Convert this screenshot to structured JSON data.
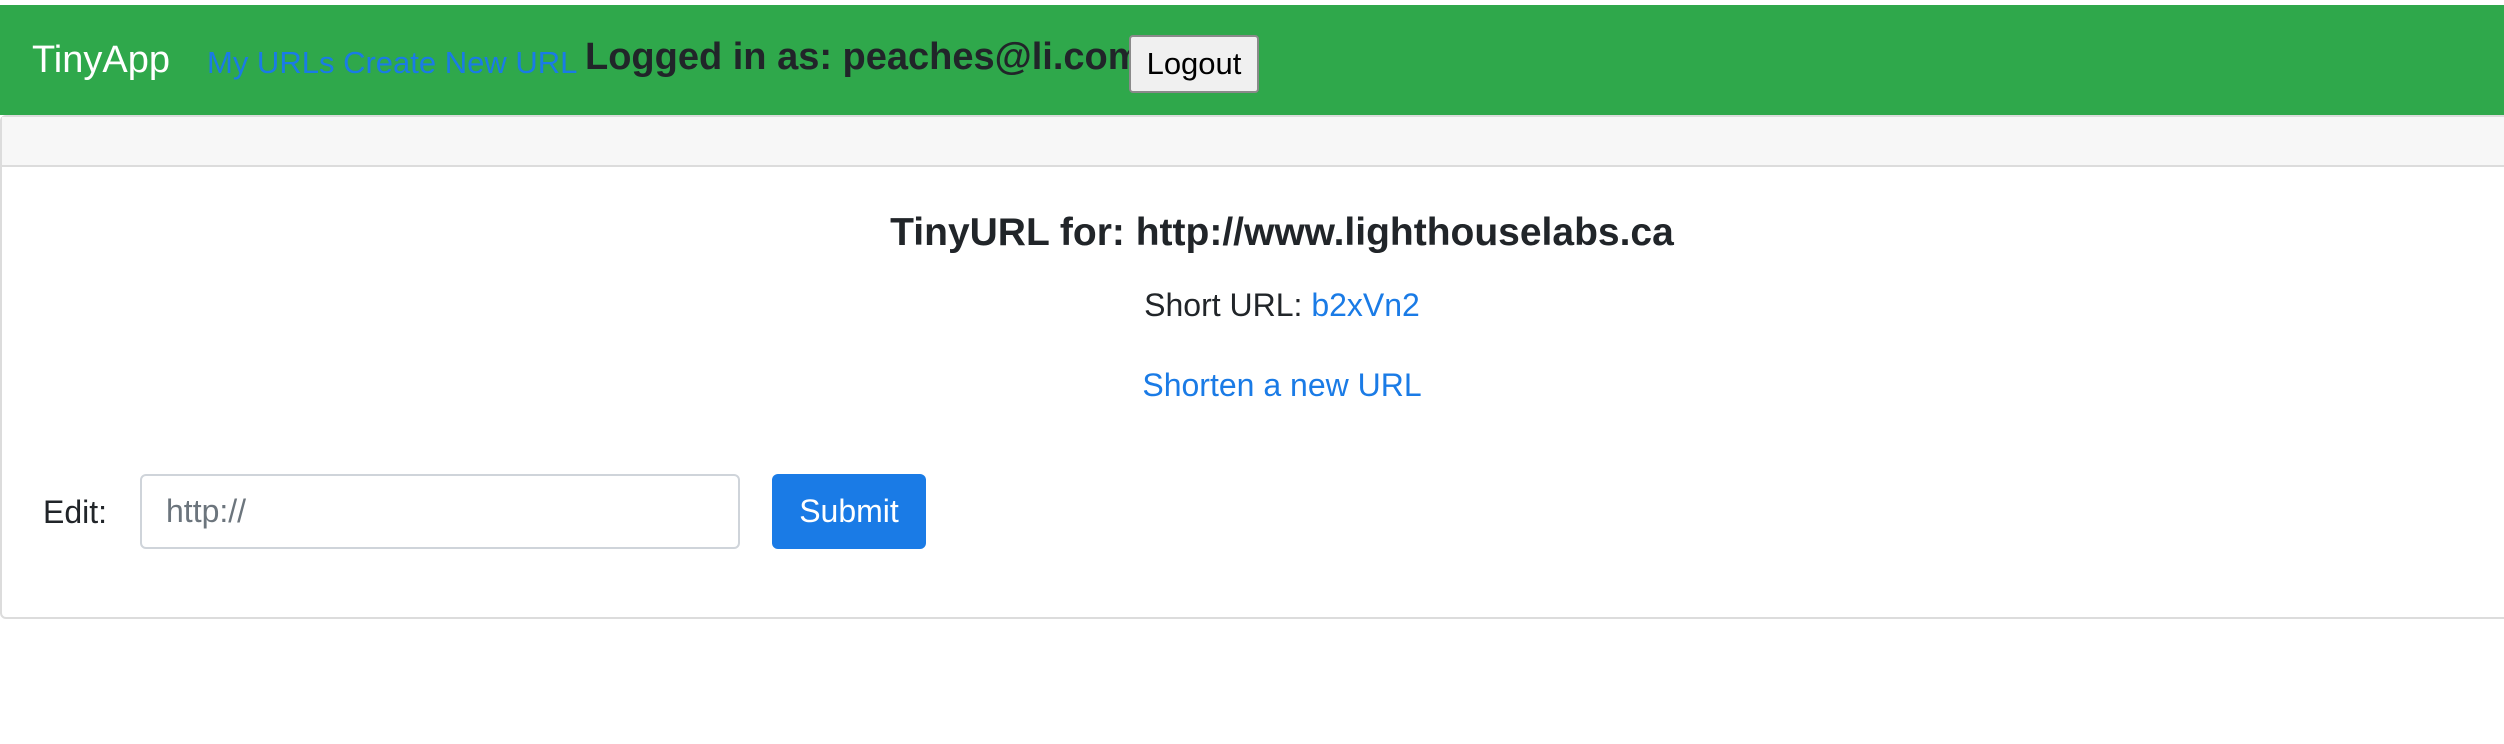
{
  "navbar": {
    "brand": "TinyApp",
    "links": [
      {
        "label": "My URLs"
      },
      {
        "label": "Create New URL"
      }
    ],
    "logged_in_text": "Logged in as: peaches@li.com",
    "logout_label": "Logout",
    "background_color": "#2fa84b",
    "link_color": "#1a7be6"
  },
  "card": {
    "title": "TinyURL for: http://www.lighthouselabs.ca",
    "short_url_label": "Short URL: ",
    "short_url_value": "b2xVn2",
    "new_url_link": "Shorten a new URL",
    "edit_form": {
      "label": "Edit:",
      "input_value": "",
      "input_placeholder": "http://",
      "submit_label": "Submit",
      "submit_color": "#1a7be6"
    }
  }
}
